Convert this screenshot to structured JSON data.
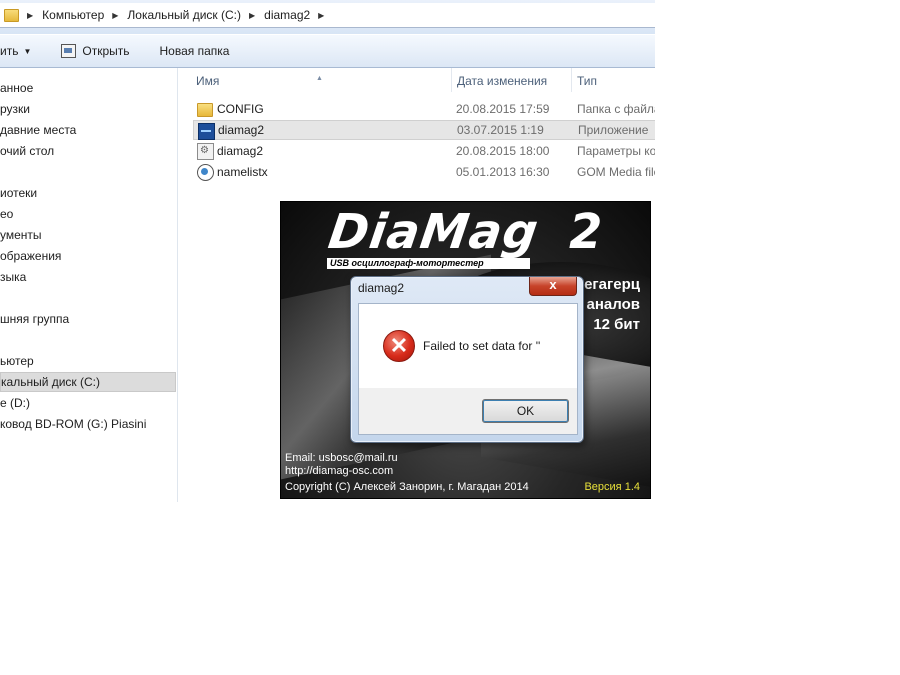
{
  "address": {
    "crumbs": [
      "Компьютер",
      "Локальный диск (C:)",
      "diamag2"
    ]
  },
  "toolbar": {
    "organize_label": "ить",
    "open_label": "Открыть",
    "new_folder_label": "Новая папка"
  },
  "nav": {
    "items": [
      {
        "label": "анное"
      },
      {
        "label": "рузки"
      },
      {
        "label": "давние места"
      },
      {
        "label": "очий стол"
      },
      {
        "label": "иотеки"
      },
      {
        "label": "ео"
      },
      {
        "label": "ументы"
      },
      {
        "label": "ображения"
      },
      {
        "label": "зыка"
      },
      {
        "label": "шняя группа"
      },
      {
        "label": "ьютер"
      },
      {
        "label": "кальный диск (C:)"
      },
      {
        "label": "e (D:)"
      },
      {
        "label": "ковод BD-ROM (G:) Piasini"
      }
    ]
  },
  "columns": {
    "name": "Имя",
    "date": "Дата изменения",
    "type": "Тип"
  },
  "files": [
    {
      "name": "CONFIG",
      "date": "20.08.2015 17:59",
      "type": "Папка с файлами",
      "icon": "folder-icon"
    },
    {
      "name": "diamag2",
      "date": "03.07.2015 1:19",
      "type": "Приложение",
      "icon": "application-icon"
    },
    {
      "name": "diamag2",
      "date": "20.08.2015 18:00",
      "type": "Параметры конфигурации",
      "icon": "config-file-icon"
    },
    {
      "name": "namelistx",
      "date": "05.01.2013 16:30",
      "type": "GOM Media file",
      "icon": "gom-file-icon"
    }
  ],
  "splash": {
    "title": "DiaMag",
    "title_number": "2",
    "subtitle": "USB осциллограф-мотортестер",
    "spec1": "егагерц",
    "spec2": "аналов",
    "spec3": "12 бит",
    "email": "Email: usbosc@mail.ru",
    "site": "http://diamag-osc.com",
    "copyright": "Copyright (C)  Алексей Занорин, г. Магадан 2014",
    "version": "Версия 1.4"
  },
  "dialog": {
    "title": "diamag2",
    "close_label": "x",
    "message": "Failed to set data for ''",
    "ok_label": "OK"
  },
  "colors": {
    "explorer_chrome": "#dce7f5",
    "error_red": "#d72b1a",
    "version_yellow": "#e7e03a"
  }
}
